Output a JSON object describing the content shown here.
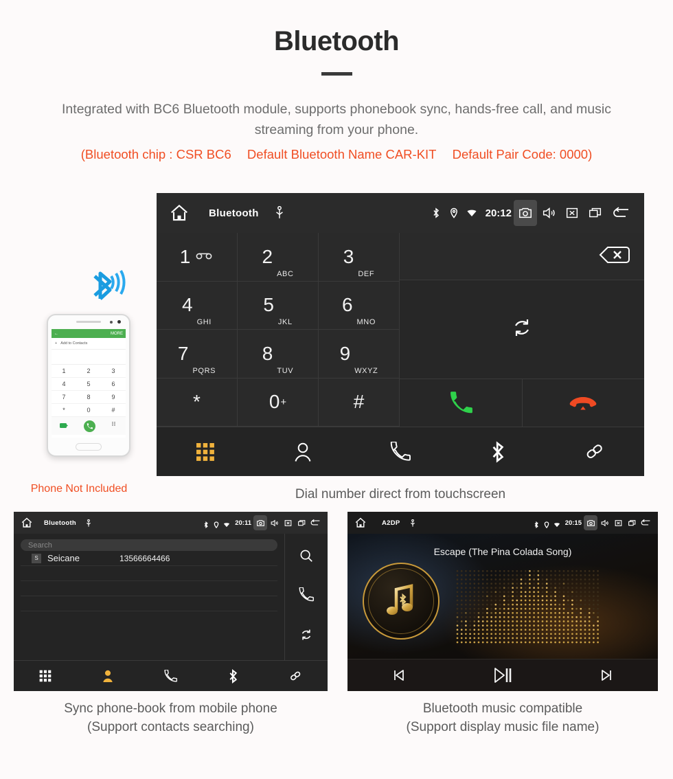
{
  "header": {
    "title": "Bluetooth",
    "intro": "Integrated with BC6 Bluetooth module, supports phonebook sync, hands-free call, and music streaming from your phone.",
    "spec_open": "(Bluetooth chip : CSR BC6",
    "spec_name": "Default Bluetooth Name CAR-KIT",
    "spec_pair": "Default Pair Code: 0000)",
    "accent_color": "#f04e23",
    "text_color": "#6d6d6d"
  },
  "dialer": {
    "statusbar": {
      "home_icon": "home-icon",
      "title": "Bluetooth",
      "usb_icon": "usb-icon",
      "bluetooth_icon": "bluetooth-icon",
      "location_icon": "location-pin-icon",
      "wifi_icon": "wifi-icon",
      "time": "20:12",
      "camera_icon": "camera-icon",
      "volume_icon": "volume-icon",
      "close_icon": "close-box-icon",
      "recents_icon": "recents-icon",
      "back_icon": "back-arrow-icon"
    },
    "keys": [
      {
        "num": "1",
        "sub": "",
        "icon": "voicemail-icon"
      },
      {
        "num": "2",
        "sub": "ABC",
        "icon": ""
      },
      {
        "num": "3",
        "sub": "DEF",
        "icon": ""
      },
      {
        "num": "4",
        "sub": "GHI",
        "icon": ""
      },
      {
        "num": "5",
        "sub": "JKL",
        "icon": ""
      },
      {
        "num": "6",
        "sub": "MNO",
        "icon": ""
      },
      {
        "num": "7",
        "sub": "PQRS",
        "icon": ""
      },
      {
        "num": "8",
        "sub": "TUV",
        "icon": ""
      },
      {
        "num": "9",
        "sub": "WXYZ",
        "icon": ""
      },
      {
        "num": "*",
        "sub": "",
        "icon": ""
      },
      {
        "num": "0",
        "sub": "",
        "icon": "plus-sign"
      },
      {
        "num": "#",
        "sub": "",
        "icon": ""
      }
    ],
    "backspace_icon": "backspace-icon",
    "sync_icon": "sync-icon",
    "call_icon": "call-green-icon",
    "hangup_icon": "hangup-red-icon",
    "nav": [
      {
        "name": "dialpad",
        "icon": "dialpad-icon",
        "active": true
      },
      {
        "name": "contacts",
        "icon": "contact-person-icon",
        "active": false
      },
      {
        "name": "call-history",
        "icon": "phone-handset-icon",
        "active": false
      },
      {
        "name": "bluetooth",
        "icon": "bluetooth-icon",
        "active": false
      },
      {
        "name": "pair",
        "icon": "link-chain-icon",
        "active": false
      }
    ],
    "active_color": "#f0b23c",
    "caption": "Dial number direct from touchscreen"
  },
  "phone_photo": {
    "bluetooth_logo": "bluetooth-signal-icon",
    "screen": {
      "more_label": "MORE",
      "back_icon": "back-arrow-icon",
      "add_contacts": "Add to Contacts",
      "keys": [
        "1",
        "2",
        "3",
        "4",
        "5",
        "6",
        "7",
        "8",
        "9",
        "*",
        "0",
        "#"
      ],
      "call_icon": "call-green-icon",
      "message_icon": "message-icon",
      "keypad_icon": "keypad-icon"
    },
    "note": "Phone Not Included",
    "note_color": "#f04e23"
  },
  "phonebook": {
    "statusbar": {
      "title": "Bluetooth",
      "time": "20:11"
    },
    "search_placeholder": "Search",
    "contacts": [
      {
        "badge": "S",
        "name": "Seicane",
        "number": "13566664466"
      }
    ],
    "empty_rows": 3,
    "side_icons": [
      "search-icon",
      "phone-handset-icon",
      "sync-icon"
    ],
    "nav": [
      {
        "name": "dialpad",
        "icon": "dialpad-icon",
        "active": false
      },
      {
        "name": "contacts",
        "icon": "contact-person-icon",
        "active": true
      },
      {
        "name": "call-history",
        "icon": "phone-handset-icon",
        "active": false
      },
      {
        "name": "bluetooth",
        "icon": "bluetooth-icon",
        "active": false
      },
      {
        "name": "pair",
        "icon": "link-chain-icon",
        "active": false
      }
    ],
    "caption_line1": "Sync phone-book from mobile phone",
    "caption_line2": "(Support contacts searching)"
  },
  "music": {
    "statusbar": {
      "title": "A2DP",
      "time": "20:15"
    },
    "song_title": "Escape (The Pina Colada Song)",
    "album_icon": "music-note-bluetooth-icon",
    "visualizer": "dot-matrix-equalizer",
    "controls": [
      {
        "name": "previous",
        "icon": "skip-previous-icon"
      },
      {
        "name": "play-pause",
        "icon": "play-pause-icon"
      },
      {
        "name": "next",
        "icon": "skip-next-icon"
      }
    ],
    "accent_color": "#d8a13c",
    "caption_line1": "Bluetooth music compatible",
    "caption_line2": "(Support display music file name)"
  }
}
